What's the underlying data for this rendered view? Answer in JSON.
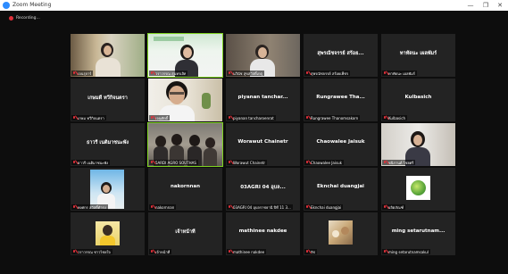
{
  "window": {
    "title": "Zoom Meeting",
    "minimize": "—",
    "restore": "❐",
    "close": "✕"
  },
  "recording": {
    "label": "Recording...",
    "color": "#e0303a"
  },
  "tiles": [
    {
      "center": "",
      "label": "เจนรุจาร์"
    },
    {
      "center": "",
      "label": "วราวรรณ สุนทรเลิศ"
    },
    {
      "center": "",
      "label": "นวินัช สุขสวัสดิ์เกตุ"
    },
    {
      "center": "สุพรณัชจรรย์ สร้อย...",
      "label": "สุพรณัชจรรย์ สร้อยเพ็ชร"
    },
    {
      "center": "ทาทัดนะ เผลพัมร์",
      "label": "ทาทัดนะ เผลพัมร์"
    },
    {
      "center": "เกษมดี ทวีกิจนตรา",
      "label": "เกษม ทวีกิจนตรา"
    },
    {
      "center": "",
      "label": "เจนศักดิ์"
    },
    {
      "center": "piyanan tanchar...",
      "label": "piyanan tancharoenrat"
    },
    {
      "center": "Rungrawee Tha...",
      "label": "Rungrawee Thanomsakorn"
    },
    {
      "center": "Kulbasich",
      "label": "Kulbasich"
    },
    {
      "center": "ธาวรี เนติมาชนะพัง",
      "label": "ธาวรี เนติมาชนะพัง"
    },
    {
      "center": "",
      "label": "5ARDI AGRO SOUTHAS"
    },
    {
      "center": "Worawut Chainetr",
      "label": "Worawut Chainetr"
    },
    {
      "center": "Chaowalee Jaisuk",
      "label": "Chaowalee Jaisuk"
    },
    {
      "center": "",
      "label": "ชนิกานต์ ไชยศรี"
    },
    {
      "center": "",
      "label": "พงศกร สวัสดิ์ดำรง"
    },
    {
      "center": "nakornnan",
      "label": "nakornnan"
    },
    {
      "center": "03AGRI 04 อุบล...",
      "label": "03AGRI 04 อุบลราชธานี ปีที่ 11 3..."
    },
    {
      "center": "Eknchai duangjai",
      "label": "Eknchai duangjai"
    },
    {
      "center": "",
      "label": "ผลิตภัณฑ์"
    },
    {
      "center": "",
      "label": "วราวรรณ ชาวไชยใจ"
    },
    {
      "center": "เจ้าหน้าที่",
      "label": "เจ้าหน้าที่"
    },
    {
      "center": "mathinee nakdee",
      "label": "mathinee nakdee"
    },
    {
      "center": "",
      "label": "รัช"
    },
    {
      "center": "ming setarutnam...",
      "label": "ming setarutnamsakul"
    }
  ]
}
